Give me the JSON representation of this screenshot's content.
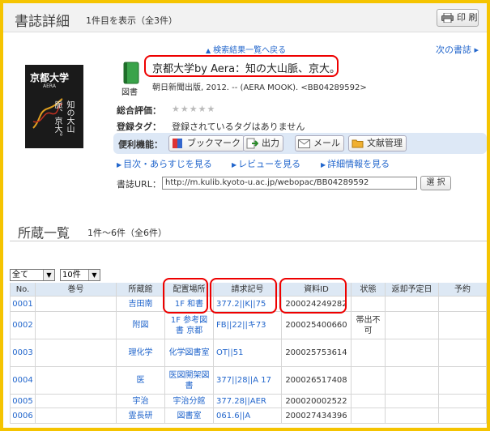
{
  "header": {
    "title": "書誌詳細",
    "count": "1件目を表示（全3件）",
    "print_label": "印 刷"
  },
  "nav": {
    "back": "検索結果一覧へ戻る",
    "next": "次の書誌 ▸"
  },
  "record": {
    "title": "京都大学by Aera：知の大山脈、京大。",
    "material_type": "図書",
    "pubinfo": "朝日新聞出版, 2012. -- (AERA MOOK). <BB04289592>",
    "rating_label": "総合評価：",
    "rating": "★★★★★",
    "tags_label": "登録タグ：",
    "tags_text": "登録されているタグはありません",
    "tools_label": "便利機能：",
    "cover_title": "京都大学",
    "cover_subtitle": "AERA",
    "cover_vertical": "知の大山脈、京大。"
  },
  "tools": {
    "bookmark": "ブックマーク",
    "output": "出力",
    "mail": "メール",
    "bibliography": "文献管理"
  },
  "links": {
    "toc": "目次・あらすじを見る",
    "review": "レビューを見る",
    "detail": "詳細情報を見る"
  },
  "url": {
    "label": "書誌URL：",
    "value": "http://m.kulib.kyoto-u.ac.jp/webopac/BB04289592",
    "select": "選 択"
  },
  "holdings": {
    "title": "所蔵一覧",
    "count": "1件～6件（全6件）",
    "filter_value": "全て",
    "per_page": "10件",
    "columns": [
      "No.",
      "巻号",
      "所蔵館",
      "配置場所",
      "請求記号",
      "資料ID",
      "状態",
      "返却予定日",
      "予約"
    ],
    "rows": [
      {
        "no": "0001",
        "vol": "",
        "lib": "吉田南",
        "loc": "1F 和書",
        "call": "377.2||K||75",
        "id": "200024249282",
        "status": ""
      },
      {
        "no": "0002",
        "vol": "",
        "lib": "附図",
        "loc": "1F 参考図書 京都",
        "call": "FB||22||キ73",
        "id": "200025400660",
        "status": "帯出不可"
      },
      {
        "no": "0003",
        "vol": "",
        "lib": "理化学",
        "loc": "化学図書室",
        "call": "OT||51",
        "id": "200025753614",
        "status": ""
      },
      {
        "no": "0004",
        "vol": "",
        "lib": "医",
        "loc": "医図開架図書",
        "call": "377||28||A 17",
        "id": "200026517408",
        "status": ""
      },
      {
        "no": "0005",
        "vol": "",
        "lib": "宇治",
        "loc": "宇治分館",
        "call": "377.28||AER",
        "id": "200020002522",
        "status": ""
      },
      {
        "no": "0006",
        "vol": "",
        "lib": "霊長研",
        "loc": "図書室",
        "call": "061.6||A",
        "id": "200027434396",
        "status": ""
      }
    ]
  }
}
